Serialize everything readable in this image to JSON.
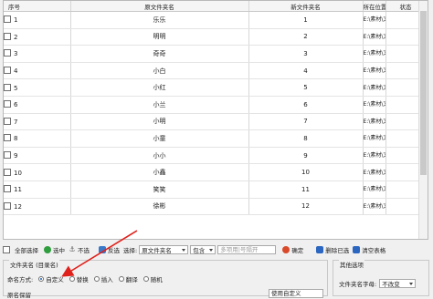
{
  "grid": {
    "headers": {
      "no": "序号",
      "original": "原文件夹名",
      "new_name": "新文件夹名",
      "location": "所在位置",
      "status": "状态"
    },
    "rows": [
      {
        "no": "1",
        "original": "乐乐",
        "new_name": "1",
        "location": "E:\\素材\\文件夹\\"
      },
      {
        "no": "2",
        "original": "明明",
        "new_name": "2",
        "location": "E:\\素材\\文件夹\\"
      },
      {
        "no": "3",
        "original": "奇奇",
        "new_name": "3",
        "location": "E:\\素材\\文件夹\\"
      },
      {
        "no": "4",
        "original": "小白",
        "new_name": "4",
        "location": "E:\\素材\\文件夹\\"
      },
      {
        "no": "5",
        "original": "小红",
        "new_name": "5",
        "location": "E:\\素材\\文件夹\\"
      },
      {
        "no": "6",
        "original": "小兰",
        "new_name": "6",
        "location": "E:\\素材\\文件夹\\"
      },
      {
        "no": "7",
        "original": "小明",
        "new_name": "7",
        "location": "E:\\素材\\文件夹\\"
      },
      {
        "no": "8",
        "original": "小童",
        "new_name": "8",
        "location": "E:\\素材\\文件夹\\"
      },
      {
        "no": "9",
        "original": "小小",
        "new_name": "9",
        "location": "E:\\素材\\文件夹\\"
      },
      {
        "no": "10",
        "original": "小鑫",
        "new_name": "10",
        "location": "E:\\素材\\文件夹\\"
      },
      {
        "no": "11",
        "original": "笑笑",
        "new_name": "11",
        "location": "E:\\素材\\文件夹\\"
      },
      {
        "no": "12",
        "original": "徐彬",
        "new_name": "12",
        "location": "E:\\素材\\文件夹\\"
      }
    ]
  },
  "toolbar": {
    "select_all": "全部选择",
    "select": "选中",
    "deselect": "不选",
    "invert": "反选",
    "choose_label": "选择:",
    "field_select": "原文件夹名",
    "op_select": "包含",
    "filter_placeholder": "多项用|号隔开",
    "confirm": "确定",
    "delete_selected": "删除已选",
    "clear_table": "清空表格"
  },
  "folder_panel": {
    "title": "文件夹名 (目录名)",
    "mode_label": "命名方式:",
    "modes": [
      "自定义",
      "替换",
      "插入",
      "翻译",
      "随机"
    ],
    "selected_mode": "自定义",
    "cut_label": "原名保留",
    "cut_value": "使用自定义"
  },
  "other_panel": {
    "title": "其他选项",
    "case_label": "文件夹名字母:",
    "case_value": "不改变"
  },
  "colors": {
    "arrow": "#e0201a",
    "radio_on": "#1a5fb4"
  }
}
